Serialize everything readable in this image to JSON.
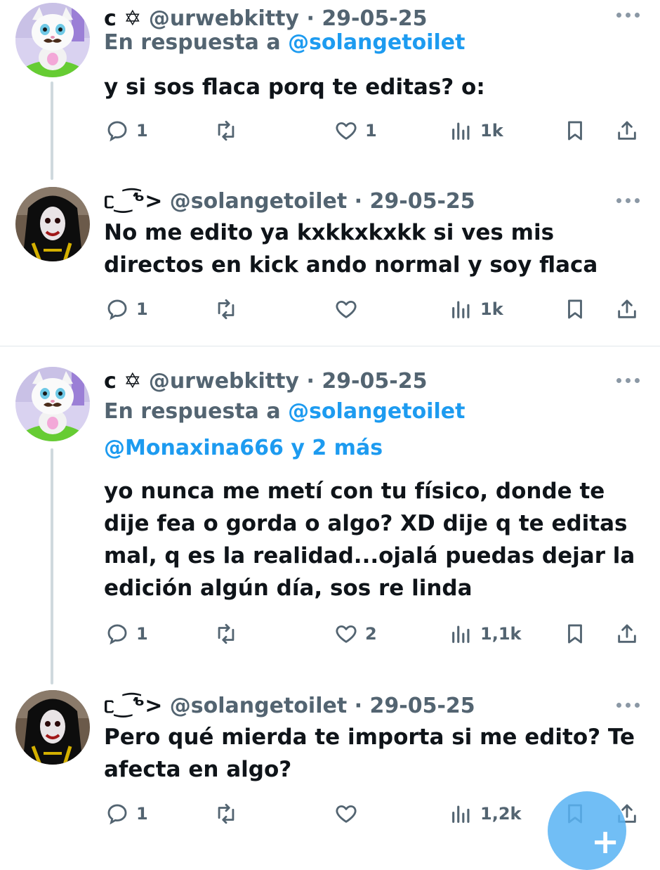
{
  "tweets": [
    {
      "display_name": "c ✡",
      "handle": "@urwebkitty",
      "sep": "·",
      "date": "29-05-25",
      "reply_prefix": "En respuesta a",
      "reply_user": "@solangetoilet",
      "reply_more": "",
      "text": "y si sos flaca porq te editas? o:",
      "replies": "1",
      "retweets": "",
      "likes": "1",
      "views": "1k"
    },
    {
      "display_name": "ᥴ‿͡ᕻ>",
      "handle": "@solangetoilet",
      "sep": "·",
      "date": "29-05-25",
      "text": "No me edito ya kxkkxkxkk si ves mis directos en kick ando normal y soy flaca",
      "replies": "1",
      "retweets": "",
      "likes": "",
      "views": "1k"
    },
    {
      "display_name": "c ✡",
      "handle": "@urwebkitty",
      "sep": "·",
      "date": "29-05-25",
      "reply_prefix": "En respuesta a",
      "reply_user": "@solangetoilet",
      "reply_more": "@Monaxina666 y 2 más",
      "text": "yo nunca me metí con tu físico, donde te dije fea o gorda o algo? XD dije q te editas mal, q es la realidad...ojalá puedas dejar la edición algún día, sos re linda",
      "replies": "1",
      "retweets": "",
      "likes": "2",
      "views": "1,1k"
    },
    {
      "display_name": "ᥴ‿͡ᕻ>",
      "handle": "@solangetoilet",
      "sep": "·",
      "date": "29-05-25",
      "text": "Pero qué mierda te importa si me edito? Te afecta en algo?",
      "replies": "1",
      "retweets": "",
      "likes": "",
      "views": "1,2k"
    }
  ],
  "fab": {
    "label": "+"
  },
  "colors": {
    "link": "#1d9bf0",
    "muted": "#536471",
    "text": "#0f1419",
    "thread": "#cfd9de",
    "fab": "#58b3f3"
  },
  "icons": [
    "reply-icon",
    "retweet-icon",
    "like-icon",
    "views-icon",
    "bookmark-icon",
    "share-icon",
    "more-icon"
  ]
}
